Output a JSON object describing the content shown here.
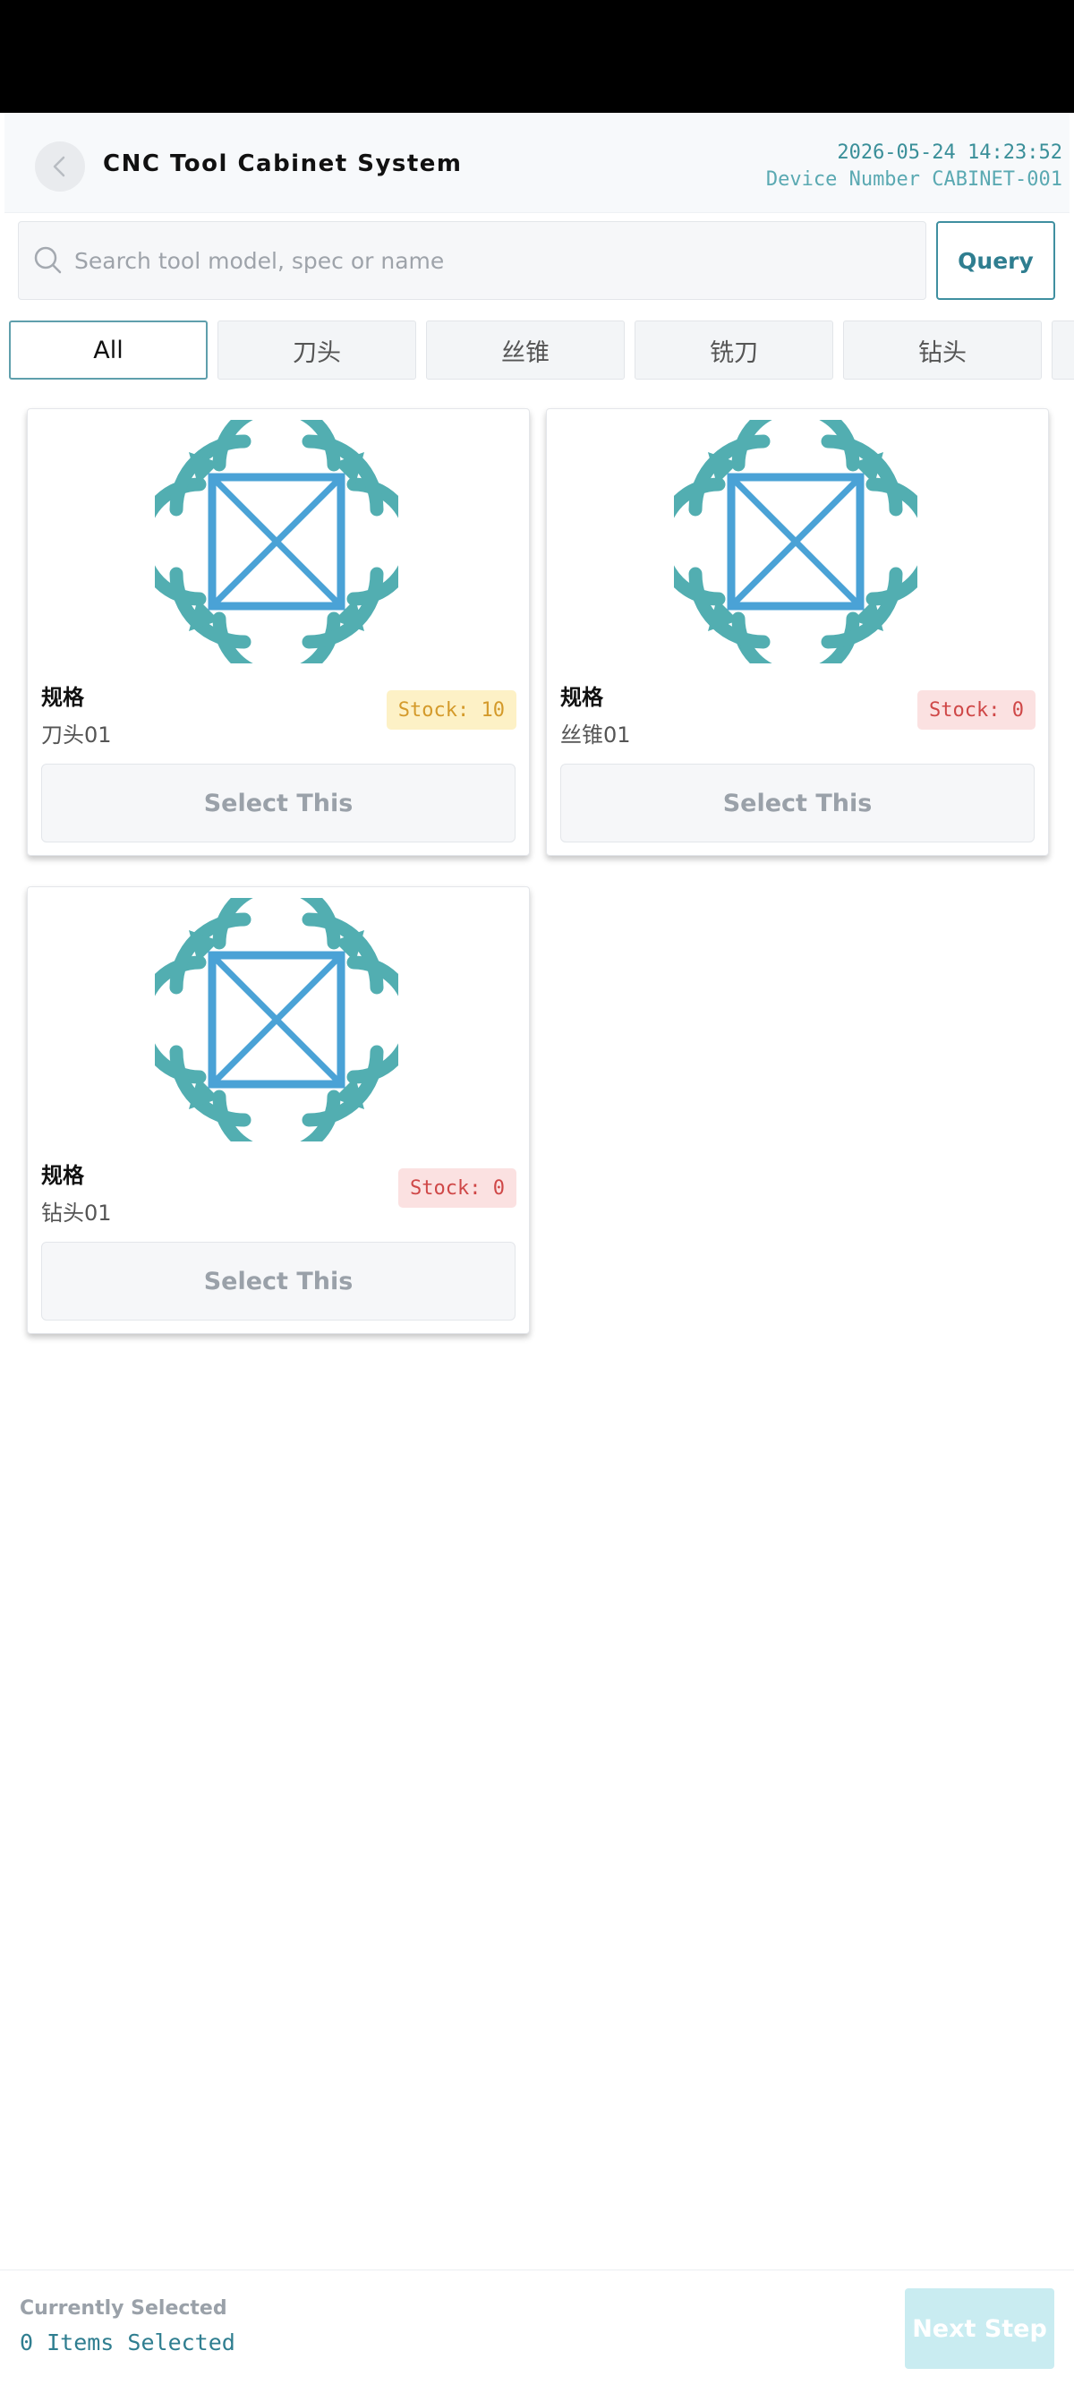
{
  "header": {
    "title": "CNC Tool Cabinet System",
    "datetime": "2026-05-24 14:23:52",
    "device": "Device Number CABINET-001"
  },
  "search": {
    "placeholder": "Search tool model, spec or name",
    "value": "",
    "query_label": "Query"
  },
  "tabs": [
    {
      "label": "All",
      "active": true
    },
    {
      "label": "刀头",
      "active": false
    },
    {
      "label": "丝锥",
      "active": false
    },
    {
      "label": "铣刀",
      "active": false
    },
    {
      "label": "钻头",
      "active": false
    }
  ],
  "cards": [
    {
      "spec_label": "规格",
      "name": "刀头01",
      "stock": "Stock: 10",
      "stock_status": "warn",
      "button": "Select This"
    },
    {
      "spec_label": "规格",
      "name": "丝锥01",
      "stock": "Stock: 0",
      "stock_status": "zero",
      "button": "Select This"
    },
    {
      "spec_label": "规格",
      "name": "钻头01",
      "stock": "Stock: 0",
      "stock_status": "zero",
      "button": "Select This"
    }
  ],
  "footer": {
    "selected_label": "Currently Selected",
    "selected_count": "0 Items Selected",
    "next_label": "Next Step"
  },
  "colors": {
    "accent": "#3f8fa0",
    "logo_teal": "#52aeb1",
    "logo_blue": "#4aa2d6",
    "stock_warn": "#d49a2a",
    "stock_zero": "#cf4747"
  }
}
